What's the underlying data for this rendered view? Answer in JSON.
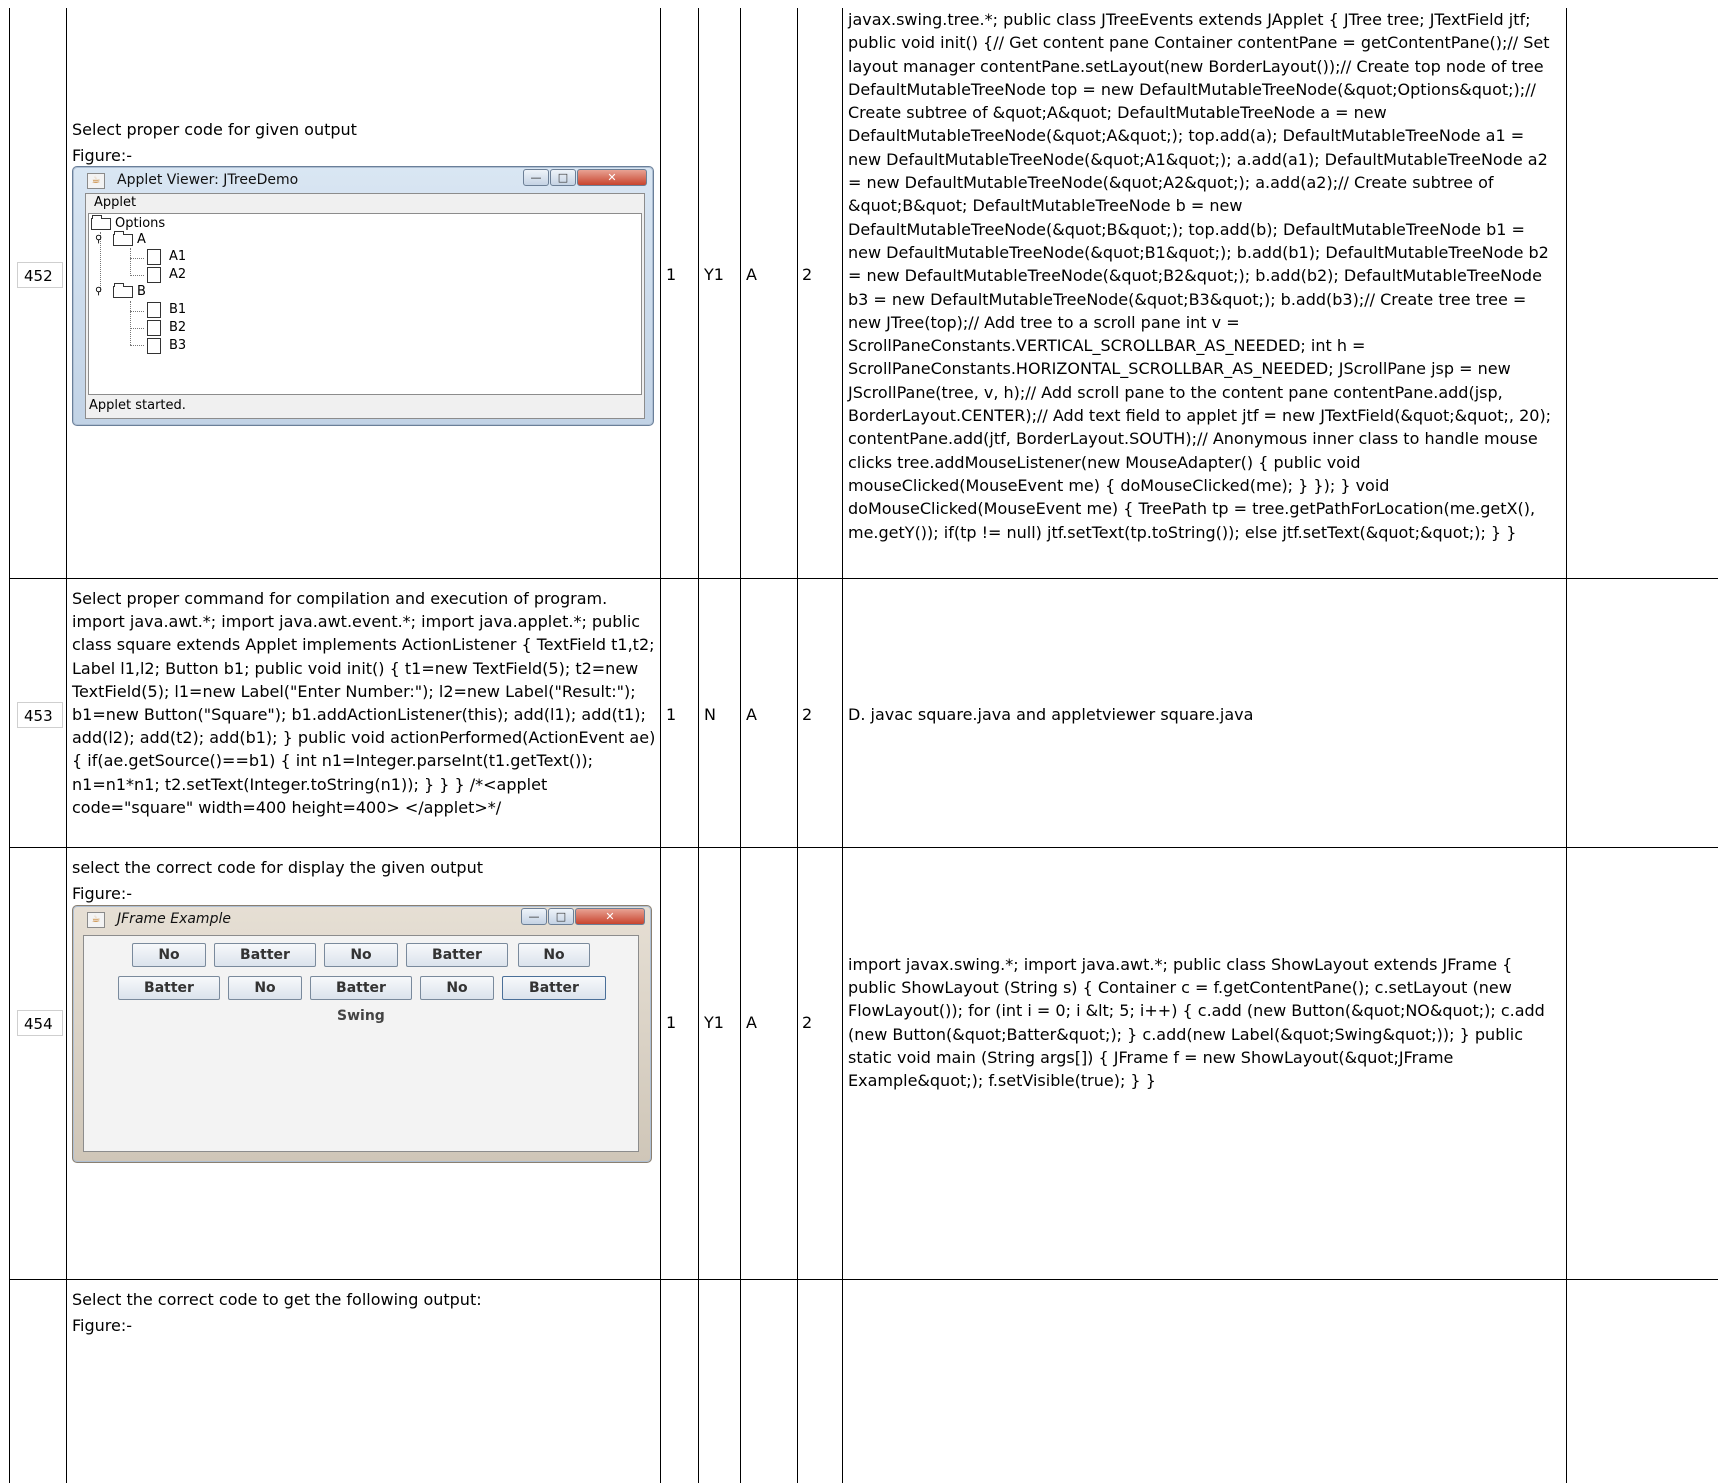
{
  "rows": [
    {
      "id": "452",
      "question_lines": [
        "Select proper code for given output",
        "Figure:-"
      ],
      "col_a": "1",
      "col_b": "Y1",
      "col_c": "A",
      "col_d": "2",
      "answer": "javax.swing.tree.*; public class JTreeEvents extends JApplet { JTree tree; JTextField jtf; public void init() {// Get content pane Container contentPane = getContentPane();// Set layout manager contentPane.setLayout(new BorderLayout());// Create top node of tree DefaultMutableTreeNode top = new DefaultMutableTreeNode(&quot;Options&quot;);// Create subtree of &quot;A&quot; DefaultMutableTreeNode a = new DefaultMutableTreeNode(&quot;A&quot;); top.add(a); DefaultMutableTreeNode a1 = new DefaultMutableTreeNode(&quot;A1&quot;); a.add(a1); DefaultMutableTreeNode a2 = new DefaultMutableTreeNode(&quot;A2&quot;); a.add(a2);// Create subtree of &quot;B&quot; DefaultMutableTreeNode b = new DefaultMutableTreeNode(&quot;B&quot;); top.add(b); DefaultMutableTreeNode b1 = new DefaultMutableTreeNode(&quot;B1&quot;); b.add(b1); DefaultMutableTreeNode b2 = new DefaultMutableTreeNode(&quot;B2&quot;); b.add(b2); DefaultMutableTreeNode b3 = new DefaultMutableTreeNode(&quot;B3&quot;); b.add(b3);// Create tree tree = new JTree(top);// Add tree to a scroll pane int v = ScrollPaneConstants.VERTICAL_SCROLLBAR_AS_NEEDED; int h = ScrollPaneConstants.HORIZONTAL_SCROLLBAR_AS_NEEDED; JScrollPane jsp = new JScrollPane(tree, v, h);// Add scroll pane to the content pane contentPane.add(jsp, BorderLayout.CENTER);// Add text field to applet jtf = new JTextField(&quot;&quot;, 20); contentPane.add(jtf, BorderLayout.SOUTH);// Anonymous inner class to handle mouse clicks tree.addMouseListener(new MouseAdapter() { public void mouseClicked(MouseEvent me) { doMouseClicked(me); } }); } void doMouseClicked(MouseEvent me) { TreePath tp = tree.getPathForLocation(me.getX(), me.getY()); if(tp != null) jtf.setText(tp.toString()); else jtf.setText(&quot;&quot;); } }",
      "figure": {
        "title": "Applet Viewer: JTreeDemo",
        "menu": "Applet",
        "status": "Applet started.",
        "nodes": [
          "Options",
          "A",
          "A1",
          "A2",
          "B",
          "B1",
          "B2",
          "B3"
        ]
      }
    },
    {
      "id": "453",
      "question": "Select proper command for compilation and execution of program. import java.awt.*; import java.awt.event.*; import java.applet.*; public class square extends Applet implements ActionListener { TextField t1,t2; Label l1,l2; Button b1; public void init() { t1=new TextField(5); t2=new TextField(5); l1=new Label(\"Enter Number:\"); l2=new Label(\"Result:\"); b1=new Button(\"Square\"); b1.addActionListener(this); add(l1); add(t1); add(l2); add(t2); add(b1); } public void actionPerformed(ActionEvent ae) { if(ae.getSource()==b1) { int n1=Integer.parseInt(t1.getText()); n1=n1*n1; t2.setText(Integer.toString(n1)); } } } /*<applet code=\"square\" width=400 height=400> </applet>*/",
      "col_a": "1",
      "col_b": "N",
      "col_c": "A",
      "col_d": "2",
      "answer": "D. javac square.java and appletviewer square.java"
    },
    {
      "id": "454",
      "question_lines": [
        "select the correct code for display the given output",
        "Figure:-"
      ],
      "col_a": "1",
      "col_b": "Y1",
      "col_c": "A",
      "col_d": "2",
      "answer": "import javax.swing.*; import java.awt.*; public class ShowLayout extends JFrame { public ShowLayout (String s) { Container c = f.getContentPane(); c.setLayout (new FlowLayout()); for (int i = 0; i &lt; 5; i++) { c.add (new Button(&quot;NO&quot;); c.add (new Button(&quot;Batter&quot;); } c.add(new Label(&quot;Swing&quot;)); } public static void main (String args[]) { JFrame f = new ShowLayout(&quot;JFrame Example&quot;); f.setVisible(true); } }",
      "figure": {
        "title": "JFrame Example",
        "buttons_row1": [
          "No",
          "Batter",
          "No",
          "Batter",
          "No"
        ],
        "buttons_row2": [
          "Batter",
          "No",
          "Batter",
          "No",
          "Batter"
        ],
        "label": "Swing"
      }
    },
    {
      "question_lines": [
        "Select the correct code to get the following output:",
        "Figure:-"
      ]
    }
  ]
}
